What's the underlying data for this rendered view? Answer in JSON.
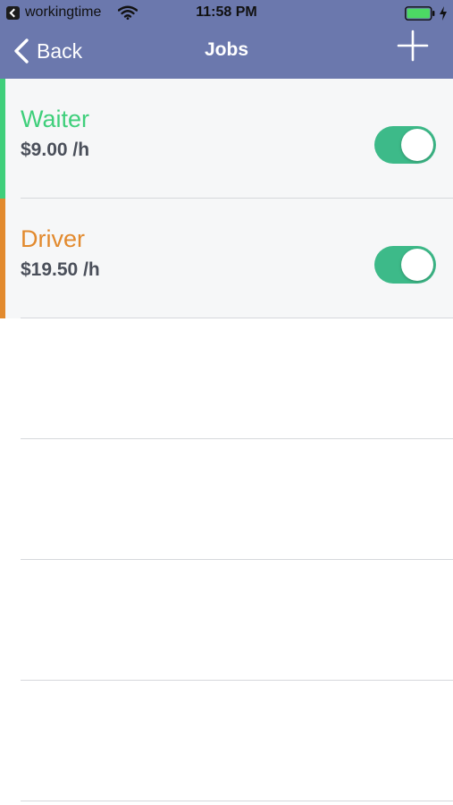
{
  "status_bar": {
    "app_name": "workingtime",
    "time": "11:58 PM",
    "icons": [
      "back-to-app-icon",
      "wifi-icon",
      "battery-icon",
      "charging-bolt-icon"
    ]
  },
  "nav": {
    "back_label": "Back",
    "title": "Jobs",
    "add_icon": "plus-icon"
  },
  "jobs": [
    {
      "name": "Waiter",
      "rate": "$9.00 /h",
      "color": "#3fcf7b",
      "enabled": true
    },
    {
      "name": "Driver",
      "rate": "$19.50 /h",
      "color": "#e28a2e",
      "enabled": true
    }
  ],
  "colors": {
    "header": "#6b78ad",
    "toggle_on": "#3dba89",
    "rate_text": "#4a4f5a"
  }
}
